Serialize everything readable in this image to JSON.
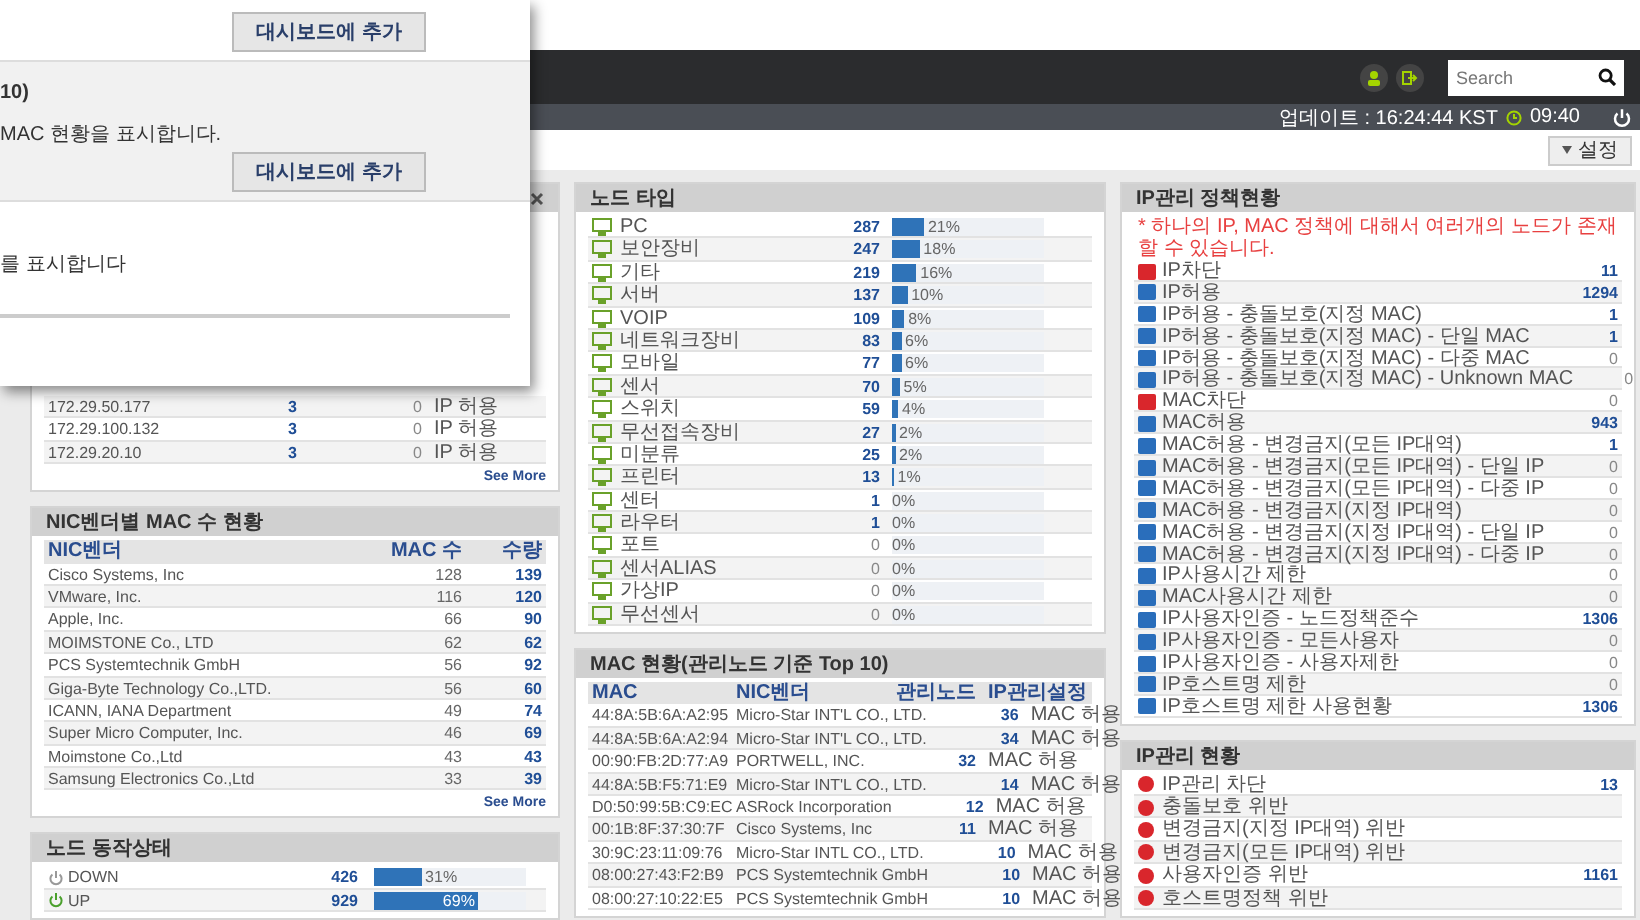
{
  "modal": {
    "sections": [
      {
        "button": "대시보드에 추가"
      },
      {
        "title": "10)",
        "description": "MAC 현황을 표시합니다.",
        "button": "대시보드에 추가"
      },
      {
        "description": "를 표시합니다"
      }
    ]
  },
  "header": {
    "search": {
      "placeholder": "Search"
    }
  },
  "status": {
    "update": "업데이트 : 16:24:44 KST",
    "uptime": "09:40"
  },
  "toolbar": {
    "settings": "설정"
  },
  "ip_panel": {
    "rows": [
      {
        "ip": "172.29.50.177",
        "count": "3",
        "zero": "0",
        "setting": "IP 허용"
      },
      {
        "ip": "172.29.100.132",
        "count": "3",
        "zero": "0",
        "setting": "IP 허용"
      },
      {
        "ip": "172.29.20.10",
        "count": "3",
        "zero": "0",
        "setting": "IP 허용"
      }
    ],
    "more": "See More"
  },
  "nic_panel": {
    "title": "NIC벤더별 MAC 수 현황",
    "columns": [
      "NIC벤더",
      "MAC 수",
      "수량"
    ],
    "rows": [
      {
        "vendor": "Cisco Systems, Inc",
        "macs": "128",
        "count": "139"
      },
      {
        "vendor": "VMware, Inc.",
        "macs": "116",
        "count": "120"
      },
      {
        "vendor": "Apple, Inc.",
        "macs": "66",
        "count": "90"
      },
      {
        "vendor": "MOIMSTONE Co., LTD",
        "macs": "62",
        "count": "62"
      },
      {
        "vendor": "PCS Systemtechnik GmbH",
        "macs": "56",
        "count": "92"
      },
      {
        "vendor": "Giga-Byte Technology Co.,LTD.",
        "macs": "56",
        "count": "60"
      },
      {
        "vendor": "ICANN, IANA Department",
        "macs": "49",
        "count": "74"
      },
      {
        "vendor": "Super Micro Computer, Inc.",
        "macs": "46",
        "count": "69"
      },
      {
        "vendor": "Moimstone Co.,Ltd",
        "macs": "43",
        "count": "43"
      },
      {
        "vendor": "Samsung Electronics Co.,Ltd",
        "macs": "33",
        "count": "39"
      }
    ],
    "more": "See More"
  },
  "status_panel": {
    "title": "노드 동작상태",
    "rows": [
      {
        "label": "DOWN",
        "count": "426",
        "level": 0.31,
        "percent": "31%",
        "up": false
      },
      {
        "label": "UP",
        "count": "929",
        "level": 0.69,
        "percent": "69%",
        "up": true
      }
    ]
  },
  "node_type": {
    "title": "노드 타입",
    "rows": [
      {
        "name": "PC",
        "count": "287",
        "link": true,
        "level": 0.21,
        "percent": "21%"
      },
      {
        "name": "보안장비",
        "count": "247",
        "link": true,
        "level": 0.18,
        "percent": "18%"
      },
      {
        "name": "기타",
        "count": "219",
        "link": true,
        "level": 0.16,
        "percent": "16%"
      },
      {
        "name": "서버",
        "count": "137",
        "link": true,
        "level": 0.1,
        "percent": "10%"
      },
      {
        "name": "VOIP",
        "count": "109",
        "link": true,
        "level": 0.08,
        "percent": "8%"
      },
      {
        "name": "네트워크장비",
        "count": "83",
        "link": true,
        "level": 0.06,
        "percent": "6%"
      },
      {
        "name": "모바일",
        "count": "77",
        "link": true,
        "level": 0.06,
        "percent": "6%"
      },
      {
        "name": "센서",
        "count": "70",
        "link": true,
        "level": 0.05,
        "percent": "5%"
      },
      {
        "name": "스위치",
        "count": "59",
        "link": true,
        "level": 0.04,
        "percent": "4%"
      },
      {
        "name": "무선접속장비",
        "count": "27",
        "link": true,
        "level": 0.02,
        "percent": "2%"
      },
      {
        "name": "미분류",
        "count": "25",
        "link": true,
        "level": 0.02,
        "percent": "2%"
      },
      {
        "name": "프린터",
        "count": "13",
        "link": true,
        "level": 0.01,
        "percent": "1%"
      },
      {
        "name": "센터",
        "count": "1",
        "link": true,
        "percent": "0%"
      },
      {
        "name": "라우터",
        "count": "1",
        "link": true,
        "percent": "0%"
      },
      {
        "name": "포트",
        "count": "0",
        "link": false,
        "percent": "0%"
      },
      {
        "name": "센서ALIAS",
        "count": "0",
        "link": false,
        "percent": "0%"
      },
      {
        "name": "가상IP",
        "count": "0",
        "link": false,
        "percent": "0%"
      },
      {
        "name": "무선센서",
        "count": "0",
        "link": false,
        "percent": "0%"
      }
    ]
  },
  "mac_panel": {
    "title": "MAC 현황(관리노드 기준 Top 10)",
    "columns": [
      "MAC",
      "NIC벤더",
      "관리노드",
      "IP관리설정"
    ],
    "rows": [
      {
        "mac": "44:8A:5B:6A:A2:95",
        "vendor": "Micro-Star INT'L CO., LTD.",
        "nodes": "36",
        "setting": "MAC 허용"
      },
      {
        "mac": "44:8A:5B:6A:A2:94",
        "vendor": "Micro-Star INT'L CO., LTD.",
        "nodes": "34",
        "setting": "MAC 허용"
      },
      {
        "mac": "00:90:FB:2D:77:A9",
        "vendor": "PORTWELL, INC.",
        "nodes": "32",
        "setting": "MAC 허용"
      },
      {
        "mac": "44:8A:5B:F5:71:E9",
        "vendor": "Micro-Star INT'L CO., LTD.",
        "nodes": "14",
        "setting": "MAC 허용"
      },
      {
        "mac": "D0:50:99:5B:C9:EC",
        "vendor": "ASRock Incorporation",
        "nodes": "12",
        "setting": "MAC 허용"
      },
      {
        "mac": "00:1B:8F:37:30:7F",
        "vendor": "Cisco Systems, Inc",
        "nodes": "11",
        "setting": "MAC 허용"
      },
      {
        "mac": "30:9C:23:11:09:76",
        "vendor": "Micro-Star INTL CO., LTD.",
        "nodes": "10",
        "setting": "MAC 허용"
      },
      {
        "mac": "08:00:27:43:F2:B9",
        "vendor": "PCS Systemtechnik GmbH",
        "nodes": "10",
        "setting": "MAC 허용"
      },
      {
        "mac": "08:00:27:10:22:E5",
        "vendor": "PCS Systemtechnik GmbH",
        "nodes": "10",
        "setting": "MAC 허용"
      }
    ]
  },
  "policy_panel": {
    "title": "IP관리 정책현황",
    "note": "* 하나의 IP, MAC 정책에 대해서 여러개의 노드가 존재할 수 있습니다.",
    "rows": [
      {
        "label": "IP차단",
        "count": "11",
        "link": true,
        "color": "#d9262c"
      },
      {
        "label": "IP허용",
        "count": "1294",
        "link": true,
        "color": "#2a6ebb"
      },
      {
        "label": "IP허용 - 충돌보호(지정 MAC)",
        "count": "1",
        "link": true,
        "color": "#2a6ebb"
      },
      {
        "label": "IP허용 - 충돌보호(지정 MAC) - 단일 MAC",
        "count": "1",
        "link": true,
        "color": "#2a6ebb"
      },
      {
        "label": "IP허용 - 충돌보호(지정 MAC) - 다중 MAC",
        "count": "0",
        "link": false,
        "color": "#2a6ebb"
      },
      {
        "label": "IP허용 - 충돌보호(지정 MAC) - Unknown MAC",
        "count": "0",
        "link": false,
        "color": "#2a6ebb"
      },
      {
        "label": "MAC차단",
        "count": "0",
        "link": false,
        "color": "#d9262c"
      },
      {
        "label": "MAC허용",
        "count": "943",
        "link": true,
        "color": "#2a6ebb"
      },
      {
        "label": "MAC허용 - 변경금지(모든 IP대역)",
        "count": "1",
        "link": true,
        "color": "#2a6ebb"
      },
      {
        "label": "MAC허용 - 변경금지(모든 IP대역) - 단일 IP",
        "count": "0",
        "link": false,
        "color": "#2a6ebb"
      },
      {
        "label": "MAC허용 - 변경금지(모든 IP대역) - 다중 IP",
        "count": "0",
        "link": false,
        "color": "#2a6ebb"
      },
      {
        "label": "MAC허용 - 변경금지(지정 IP대역)",
        "count": "0",
        "link": false,
        "color": "#2a6ebb"
      },
      {
        "label": "MAC허용 - 변경금지(지정 IP대역) - 단일 IP",
        "count": "0",
        "link": false,
        "color": "#2a6ebb"
      },
      {
        "label": "MAC허용 - 변경금지(지정 IP대역) - 다중 IP",
        "count": "0",
        "link": false,
        "color": "#2a6ebb"
      },
      {
        "label": "IP사용시간 제한",
        "count": "0",
        "link": false,
        "color": "#2a6ebb"
      },
      {
        "label": "MAC사용시간 제한",
        "count": "0",
        "link": false,
        "color": "#2a6ebb"
      },
      {
        "label": "IP사용자인증 - 노드정책준수",
        "count": "1306",
        "link": true,
        "color": "#2a6ebb"
      },
      {
        "label": "IP사용자인증 - 모든사용자",
        "count": "0",
        "link": false,
        "color": "#2a6ebb"
      },
      {
        "label": "IP사용자인증 - 사용자제한",
        "count": "0",
        "link": false,
        "color": "#2a6ebb"
      },
      {
        "label": "IP호스트명 제한",
        "count": "0",
        "link": false,
        "color": "#2a6ebb"
      },
      {
        "label": "IP호스트명 제한 사용현황",
        "count": "1306",
        "link": true,
        "color": "#2a6ebb"
      }
    ]
  },
  "ip_status_panel": {
    "title": "IP관리 현황",
    "rows": [
      {
        "label": "IP관리 차단",
        "count": "13",
        "color": "#d9262c"
      },
      {
        "label": "충돌보호 위반",
        "color": "#d9262c"
      },
      {
        "label": "변경금지(지정 IP대역) 위반",
        "color": "#d9262c"
      },
      {
        "label": "변경금지(모든 IP대역) 위반",
        "color": "#d9262c"
      },
      {
        "label": "사용자인증 위반",
        "count": "1161",
        "color": "#d9262c"
      },
      {
        "label": "호스트명정책 위반",
        "color": "#d9262c"
      }
    ]
  }
}
